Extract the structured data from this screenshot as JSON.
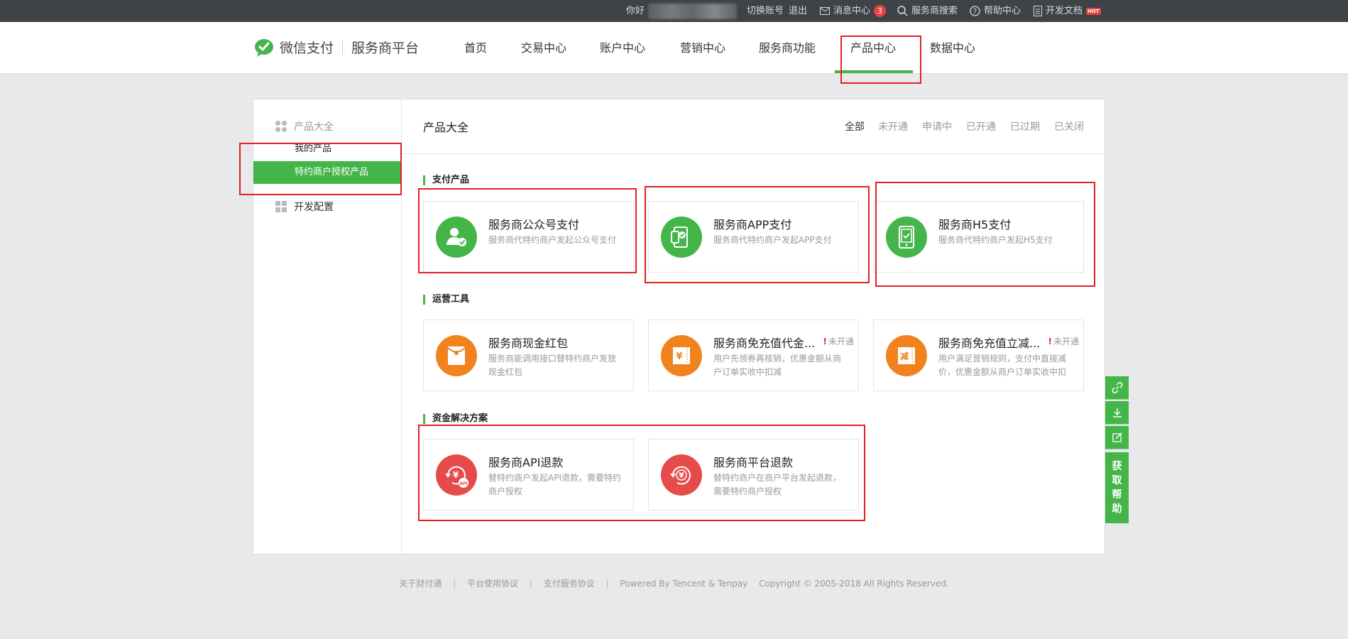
{
  "topbar": {
    "greeting": "你好",
    "switch_account": "切换账号",
    "logout": "退出",
    "messages": "消息中心",
    "message_count": "3",
    "search": "服务商搜索",
    "help": "帮助中心",
    "docs": "开发文档",
    "docs_badge": "HOT"
  },
  "header": {
    "brand": "微信支付",
    "platform": "服务商平台",
    "nav": [
      "首页",
      "交易中心",
      "账户中心",
      "营销中心",
      "服务商功能",
      "产品中心",
      "数据中心"
    ],
    "active_nav": "产品中心"
  },
  "sidebar": {
    "group1": "产品大全",
    "items": [
      "我的产品",
      "特约商户授权产品"
    ],
    "active_item": "特约商户授权产品",
    "group2": "开发配置"
  },
  "content": {
    "title": "产品大全",
    "filters": [
      "全部",
      "未开通",
      "申请中",
      "已开通",
      "已过期",
      "已关闭"
    ],
    "active_filter": "全部",
    "sections": [
      {
        "title": "支付产品",
        "cards": [
          {
            "title": "服务商公众号支付",
            "desc": "服务商代特约商户发起公众号支付",
            "icon": "user-check-icon",
            "color": "#44b549"
          },
          {
            "title": "服务商APP支付",
            "desc": "服务商代特约商户发起APP支付",
            "icon": "phone-app-icon",
            "color": "#44b549"
          },
          {
            "title": "服务商H5支付",
            "desc": "服务商代特约商户发起H5支付",
            "icon": "phone-check-icon",
            "color": "#44b549"
          }
        ]
      },
      {
        "title": "运营工具",
        "cards": [
          {
            "title": "服务商现金红包",
            "desc": "服务商能调用接口替特约商户发放现金红包",
            "icon": "red-packet-icon",
            "color": "#f1821e"
          },
          {
            "title": "服务商免充值代金...",
            "desc": "用户先领券再核销，优惠金额从商户订单实收中扣减",
            "icon": "coupon-yuan-icon",
            "color": "#f1821e",
            "status_mark": "!",
            "status": "未开通"
          },
          {
            "title": "服务商免充值立减...",
            "desc": "用户满足营销规则，支付中直接减价，优惠金额从商户订单实收中扣",
            "icon": "discount-icon",
            "color": "#f1821e",
            "status_mark": "!",
            "status": "未开通",
            "icon_text": "减"
          }
        ]
      },
      {
        "title": "资金解决方案",
        "cards": [
          {
            "title": "服务商API退款",
            "desc": "替特约商户发起API退款，需要特约商户授权",
            "icon": "refund-api-icon",
            "color": "#e54b4b",
            "icon_text": "API"
          },
          {
            "title": "服务商平台退款",
            "desc": "替特约商户在商户平台发起退款，需要特约商户授权",
            "icon": "refund-yuan-icon",
            "color": "#e54b4b"
          }
        ]
      }
    ]
  },
  "floatbar": {
    "help_chars": [
      "获",
      "取",
      "帮",
      "助"
    ]
  },
  "footer": {
    "links": [
      "关于财付通",
      "平台使用协议",
      "支付服务协议"
    ],
    "powered": "Powered By Tencent & Tenpay",
    "copyright": "Copyright © 2005-2018 All Rights Reserved."
  }
}
